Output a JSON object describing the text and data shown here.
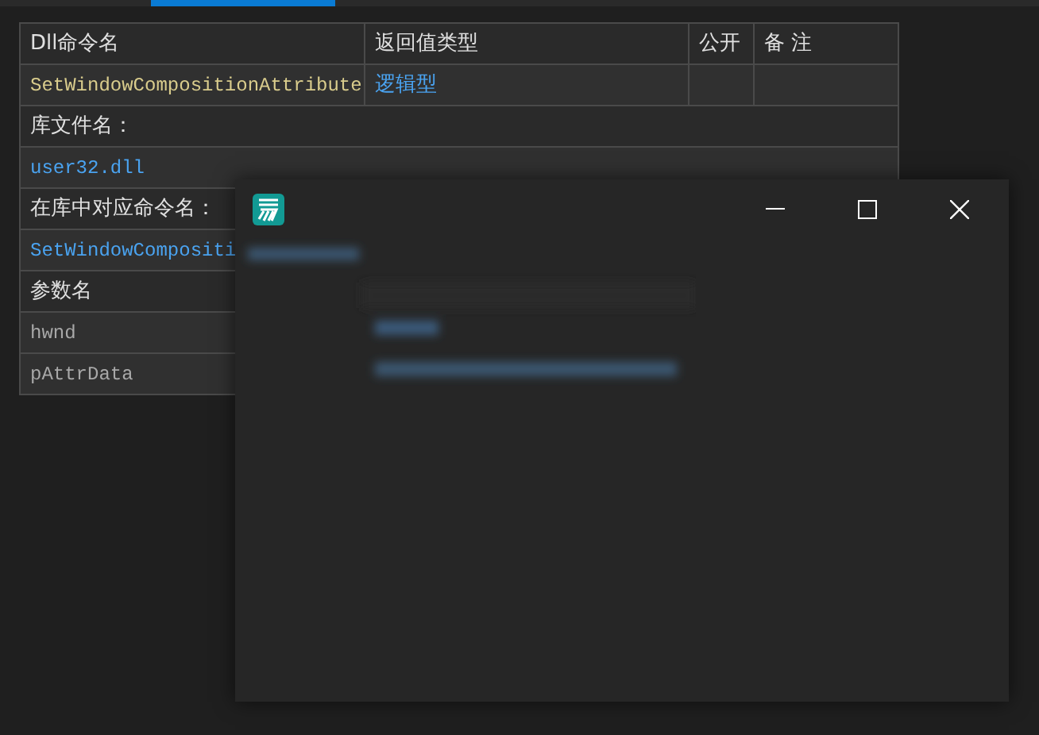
{
  "dll_table": {
    "columns": [
      "Dll命令名",
      "返回值类型",
      "公开",
      "备 注"
    ],
    "command": {
      "name": "SetWindowCompositionAttribute",
      "return_type": "逻辑型"
    },
    "library_label": "库文件名：",
    "library": "user32.dll",
    "lib_command_label": "在库中对应命令名：",
    "lib_command": "SetWindowCompositi",
    "params_label": "参数名",
    "params": [
      "hwnd",
      "pAttrData"
    ]
  }
}
